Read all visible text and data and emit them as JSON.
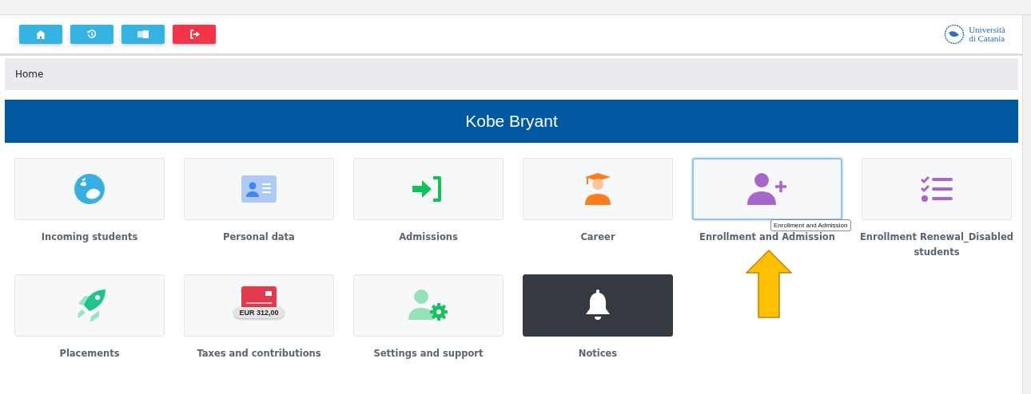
{
  "toolbar": {
    "buttons": [
      {
        "kind": "home",
        "color": "#35b4e4"
      },
      {
        "kind": "history",
        "color": "#35b4e4"
      },
      {
        "kind": "card",
        "color": "#35b4e4"
      },
      {
        "kind": "logout",
        "color": "#f5344a"
      }
    ]
  },
  "logo": {
    "lines": [
      "Università",
      "di Catania"
    ]
  },
  "breadcrumb": "Home",
  "banner": {
    "title": "Kobe Bryant"
  },
  "tiles": [
    {
      "label": "Incoming students",
      "kind": "globe",
      "dark": false,
      "highlighted": false
    },
    {
      "label": "Personal data",
      "kind": "id-card",
      "dark": false,
      "highlighted": false
    },
    {
      "label": "Admissions",
      "kind": "sign-in",
      "dark": false,
      "highlighted": false
    },
    {
      "label": "Career",
      "kind": "graduate",
      "dark": false,
      "highlighted": false
    },
    {
      "label": "Enrollment and Admission",
      "kind": "user-plus",
      "dark": false,
      "highlighted": true,
      "tooltip": "Enrollment and Admission"
    },
    {
      "label": "Enrollment Renewal_Disabled students",
      "kind": "checklist",
      "dark": false,
      "highlighted": false
    },
    {
      "label": "Placements",
      "kind": "rocket",
      "dark": false,
      "highlighted": false
    },
    {
      "label": "Taxes and contributions",
      "kind": "payment",
      "dark": false,
      "highlighted": false,
      "badge": "EUR 312,00"
    },
    {
      "label": "Settings and support",
      "kind": "user-gear",
      "dark": false,
      "highlighted": false
    },
    {
      "label": "Notices",
      "kind": "bell",
      "dark": true,
      "highlighted": false
    }
  ]
}
